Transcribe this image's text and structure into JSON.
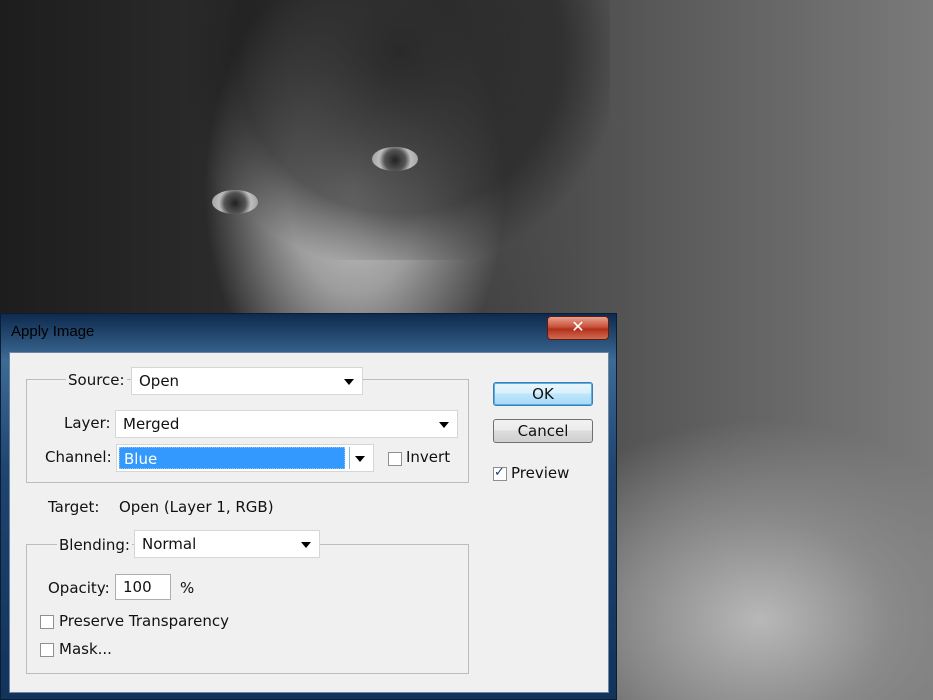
{
  "dialog": {
    "title": "Apply Image",
    "close_glyph": "✕"
  },
  "source": {
    "label": "Source:",
    "value": "Open",
    "layer_label": "Layer:",
    "layer_value": "Merged",
    "channel_label": "Channel:",
    "channel_value": "Blue",
    "invert_label": "Invert",
    "invert_checked": false
  },
  "target": {
    "label": "Target:",
    "value": "Open (Layer 1, RGB)"
  },
  "blending": {
    "label": "Blending:",
    "value": "Normal",
    "opacity_label": "Opacity:",
    "opacity_value": "100",
    "opacity_unit": "%",
    "preserve_label": "Preserve Transparency",
    "preserve_checked": false,
    "mask_label": "Mask...",
    "mask_checked": false
  },
  "buttons": {
    "ok_label": "OK",
    "cancel_label": "Cancel",
    "preview_label": "Preview",
    "preview_checked": true
  },
  "colors": {
    "selection": "#3399ff",
    "close_red": "#c9523b",
    "titlebar_blue": "#1f4470"
  }
}
